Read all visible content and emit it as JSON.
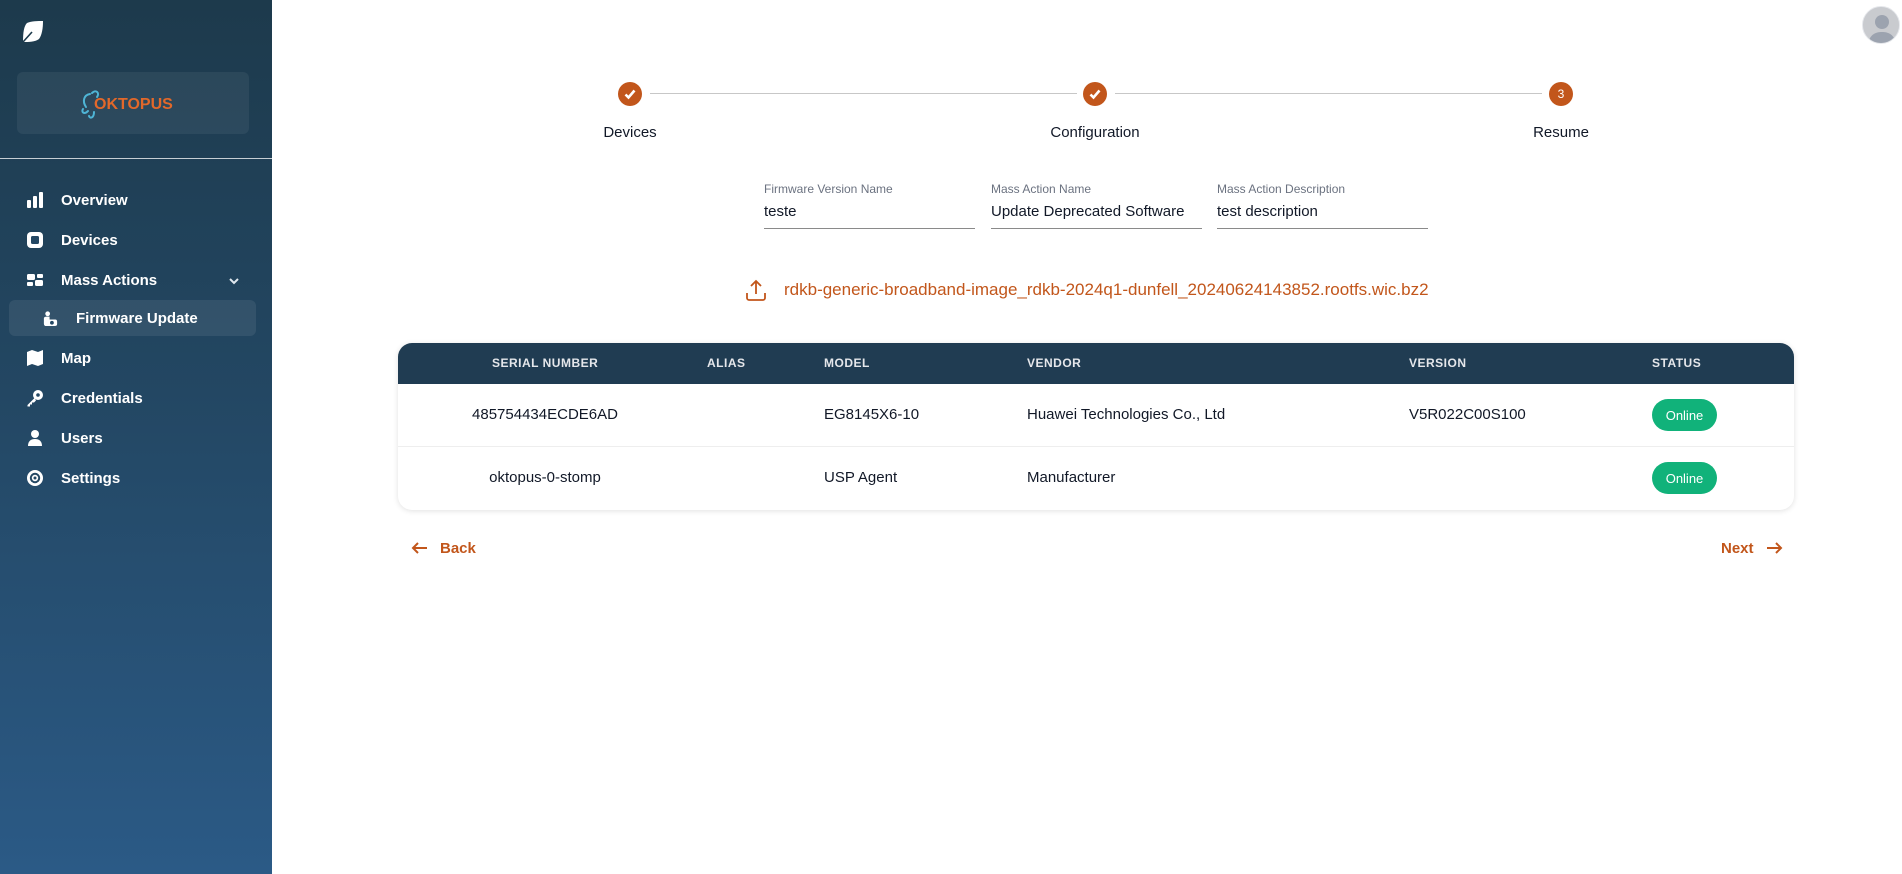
{
  "brand": {
    "logo_text": "OKTOPUS"
  },
  "sidebar": {
    "items": [
      {
        "label": "Overview",
        "icon": "bar-chart-icon"
      },
      {
        "label": "Devices",
        "icon": "device-icon"
      },
      {
        "label": "Mass Actions",
        "icon": "mass-actions-icon",
        "expanded": true
      },
      {
        "label": "Map",
        "icon": "map-icon"
      },
      {
        "label": "Credentials",
        "icon": "key-icon"
      },
      {
        "label": "Users",
        "icon": "user-icon"
      },
      {
        "label": "Settings",
        "icon": "settings-icon"
      }
    ],
    "sub_items": [
      {
        "label": "Firmware Update",
        "icon": "firmware-icon",
        "active": true
      }
    ]
  },
  "stepper": {
    "steps": [
      {
        "label": "Devices",
        "state": "completed"
      },
      {
        "label": "Configuration",
        "state": "completed"
      },
      {
        "label": "Resume",
        "state": "active",
        "number": "3"
      }
    ]
  },
  "form": {
    "firmware_version_name": {
      "label": "Firmware Version Name",
      "value": "teste"
    },
    "mass_action_name": {
      "label": "Mass Action Name",
      "value": "Update Deprecated Software"
    },
    "mass_action_description": {
      "label": "Mass Action Description",
      "value": "test description"
    }
  },
  "upload": {
    "file_name": "rdkb-generic-broadband-image_rdkb-2024q1-dunfell_20240624143852.rootfs.wic.bz2"
  },
  "table": {
    "columns": [
      "SERIAL NUMBER",
      "ALIAS",
      "MODEL",
      "VENDOR",
      "VERSION",
      "STATUS"
    ],
    "rows": [
      {
        "serial_number": "485754434ECDE6AD",
        "alias": "",
        "model": "EG8145X6-10",
        "vendor": "Huawei Technologies Co., Ltd",
        "version": "V5R022C00S100",
        "status": "Online"
      },
      {
        "serial_number": "oktopus-0-stomp",
        "alias": "",
        "model": "USP Agent",
        "vendor": "Manufacturer",
        "version": "",
        "status": "Online"
      }
    ]
  },
  "actions": {
    "back_label": "Back",
    "next_label": "Next"
  },
  "colors": {
    "accent": "#c2561b",
    "header": "#203c52",
    "online": "#11b27a",
    "sidebar_top": "#1d3a4c",
    "sidebar_bottom": "#2b5a86"
  }
}
